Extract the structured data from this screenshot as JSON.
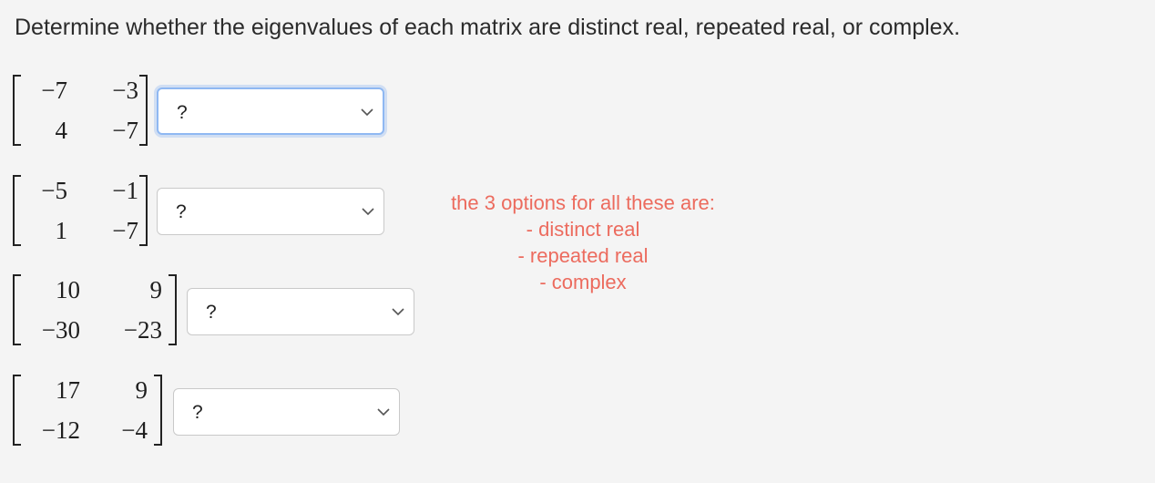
{
  "prompt": "Determine whether the eigenvalues of each matrix are distinct real, repeated real, or complex.",
  "questions": [
    {
      "matrix": [
        [
          "−7",
          "−3"
        ],
        [
          "4",
          "−7"
        ]
      ],
      "selected": "?"
    },
    {
      "matrix": [
        [
          "−5",
          "−1"
        ],
        [
          "1",
          "−7"
        ]
      ],
      "selected": "?"
    },
    {
      "matrix": [
        [
          "10",
          "9"
        ],
        [
          "−30",
          "−23"
        ]
      ],
      "selected": "?"
    },
    {
      "matrix": [
        [
          "17",
          "9"
        ],
        [
          "−12",
          "−4"
        ]
      ],
      "selected": "?"
    }
  ],
  "annotation": {
    "line1": "the 3 options for all these are:",
    "line2": "- distinct real",
    "line3": "- repeated real",
    "line4": "- complex"
  },
  "colors": {
    "annotation": "#ec6b5e",
    "focus_border": "#8fb8f2"
  }
}
